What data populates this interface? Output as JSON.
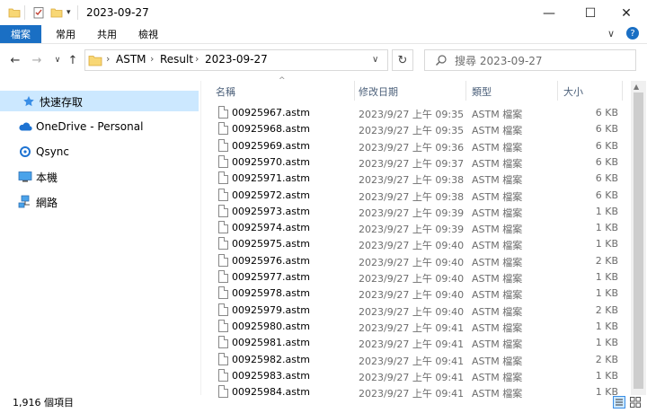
{
  "window": {
    "title": "2023-09-27",
    "minimize": "—",
    "maximize": "☐",
    "close": "✕",
    "collapse": "∨",
    "help": "?"
  },
  "ribbon": {
    "tabs": [
      "檔案",
      "常用",
      "共用",
      "檢視"
    ]
  },
  "address": {
    "back": "←",
    "forward": "→",
    "recent": "∨",
    "up": "↑",
    "crumbs": [
      "ASTM",
      "Result",
      "2023-09-27"
    ],
    "dropdown": "∨",
    "refresh": "↻",
    "search_placeholder": "搜尋 2023-09-27"
  },
  "nav": {
    "items": [
      {
        "label": "快速存取",
        "icon": "star-icon"
      },
      {
        "label": "OneDrive - Personal",
        "icon": "cloud-icon"
      },
      {
        "label": "Qsync",
        "icon": "qsync-icon"
      },
      {
        "label": "本機",
        "icon": "computer-icon"
      },
      {
        "label": "網路",
        "icon": "network-icon"
      }
    ]
  },
  "columns": {
    "name": "名稱",
    "date": "修改日期",
    "type": "類型",
    "size": "大小",
    "sort_indicator": "^"
  },
  "files": [
    {
      "name": "00925967.astm",
      "date": "2023/9/27 上午 09:35",
      "type": "ASTM 檔案",
      "size": "6 KB"
    },
    {
      "name": "00925968.astm",
      "date": "2023/9/27 上午 09:35",
      "type": "ASTM 檔案",
      "size": "6 KB"
    },
    {
      "name": "00925969.astm",
      "date": "2023/9/27 上午 09:36",
      "type": "ASTM 檔案",
      "size": "6 KB"
    },
    {
      "name": "00925970.astm",
      "date": "2023/9/27 上午 09:37",
      "type": "ASTM 檔案",
      "size": "6 KB"
    },
    {
      "name": "00925971.astm",
      "date": "2023/9/27 上午 09:38",
      "type": "ASTM 檔案",
      "size": "6 KB"
    },
    {
      "name": "00925972.astm",
      "date": "2023/9/27 上午 09:38",
      "type": "ASTM 檔案",
      "size": "6 KB"
    },
    {
      "name": "00925973.astm",
      "date": "2023/9/27 上午 09:39",
      "type": "ASTM 檔案",
      "size": "1 KB"
    },
    {
      "name": "00925974.astm",
      "date": "2023/9/27 上午 09:39",
      "type": "ASTM 檔案",
      "size": "1 KB"
    },
    {
      "name": "00925975.astm",
      "date": "2023/9/27 上午 09:40",
      "type": "ASTM 檔案",
      "size": "1 KB"
    },
    {
      "name": "00925976.astm",
      "date": "2023/9/27 上午 09:40",
      "type": "ASTM 檔案",
      "size": "2 KB"
    },
    {
      "name": "00925977.astm",
      "date": "2023/9/27 上午 09:40",
      "type": "ASTM 檔案",
      "size": "1 KB"
    },
    {
      "name": "00925978.astm",
      "date": "2023/9/27 上午 09:40",
      "type": "ASTM 檔案",
      "size": "1 KB"
    },
    {
      "name": "00925979.astm",
      "date": "2023/9/27 上午 09:40",
      "type": "ASTM 檔案",
      "size": "2 KB"
    },
    {
      "name": "00925980.astm",
      "date": "2023/9/27 上午 09:41",
      "type": "ASTM 檔案",
      "size": "1 KB"
    },
    {
      "name": "00925981.astm",
      "date": "2023/9/27 上午 09:41",
      "type": "ASTM 檔案",
      "size": "1 KB"
    },
    {
      "name": "00925982.astm",
      "date": "2023/9/27 上午 09:41",
      "type": "ASTM 檔案",
      "size": "2 KB"
    },
    {
      "name": "00925983.astm",
      "date": "2023/9/27 上午 09:41",
      "type": "ASTM 檔案",
      "size": "1 KB"
    },
    {
      "name": "00925984.astm",
      "date": "2023/9/27 上午 09:41",
      "type": "ASTM 檔案",
      "size": "1 KB"
    }
  ],
  "status": {
    "item_count": "1,916 個項目"
  },
  "colors": {
    "accent": "#1a6fc4",
    "selection": "#cce8ff",
    "folder": "#f8d775"
  }
}
